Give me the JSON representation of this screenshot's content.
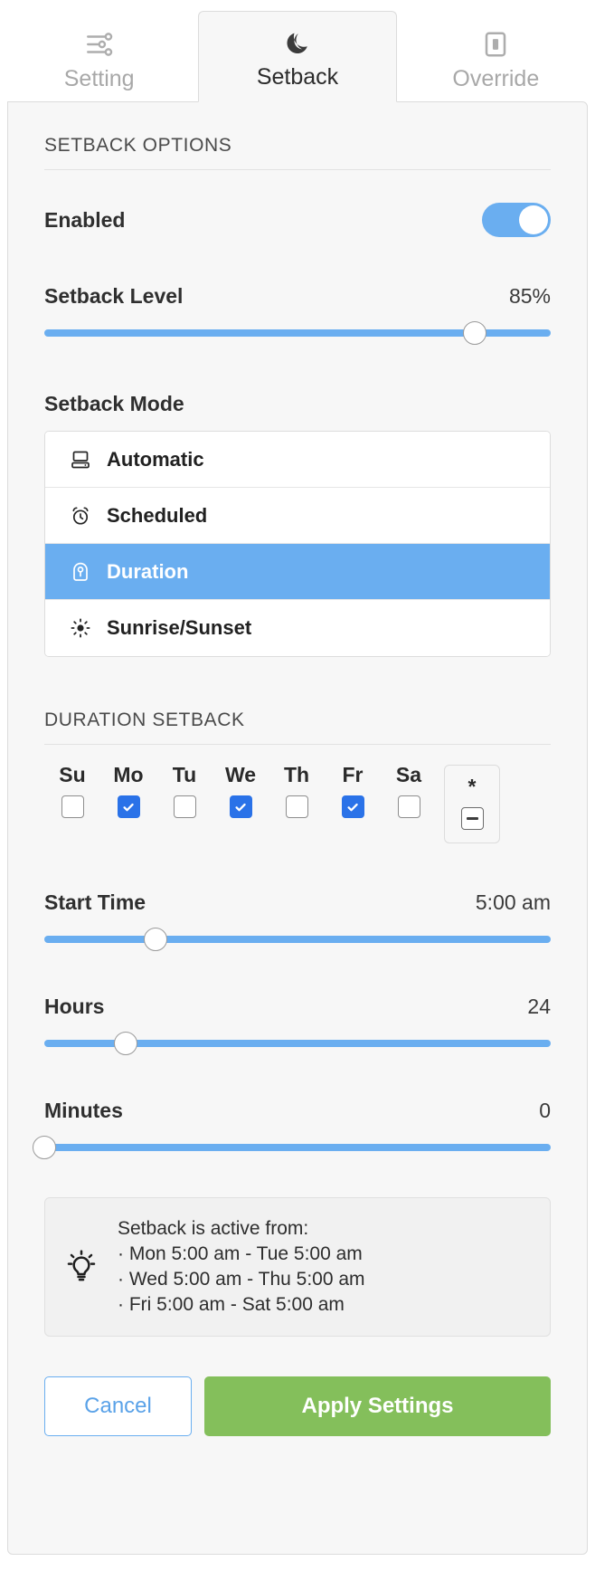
{
  "tabs": [
    {
      "label": "Setting",
      "icon": "sliders-icon",
      "active": false
    },
    {
      "label": "Setback",
      "icon": "moon-icon",
      "active": true
    },
    {
      "label": "Override",
      "icon": "switch-icon",
      "active": false
    }
  ],
  "options_section": {
    "title": "SETBACK OPTIONS",
    "enabled_label": "Enabled",
    "enabled_value": "on",
    "level_label": "Setback Level",
    "level_value": "85%",
    "level_percent": 85,
    "mode_label": "Setback Mode",
    "modes": [
      {
        "label": "Automatic",
        "icon": "computer-icon",
        "selected": false
      },
      {
        "label": "Scheduled",
        "icon": "alarm-clock-icon",
        "selected": false
      },
      {
        "label": "Duration",
        "icon": "duration-icon",
        "selected": true
      },
      {
        "label": "Sunrise/Sunset",
        "icon": "sun-icon",
        "selected": false
      }
    ]
  },
  "duration_section": {
    "title": "DURATION SETBACK",
    "days": [
      {
        "label": "Su",
        "checked": false
      },
      {
        "label": "Mo",
        "checked": true
      },
      {
        "label": "Tu",
        "checked": false
      },
      {
        "label": "We",
        "checked": true
      },
      {
        "label": "Th",
        "checked": false
      },
      {
        "label": "Fr",
        "checked": true
      },
      {
        "label": "Sa",
        "checked": false
      }
    ],
    "all_days": {
      "label": "*",
      "state": "indeterminate"
    },
    "start_time_label": "Start Time",
    "start_time_value": "5:00 am",
    "start_time_percent": 22,
    "hours_label": "Hours",
    "hours_value": "24",
    "hours_percent": 16,
    "minutes_label": "Minutes",
    "minutes_value": "0",
    "minutes_percent": 0
  },
  "info": {
    "icon": "lightbulb-icon",
    "heading": "Setback is active from:",
    "lines": [
      "· Mon 5:00 am - Tue 5:00 am",
      "· Wed 5:00 am - Thu 5:00 am",
      "· Fri 5:00 am - Sat 5:00 am"
    ]
  },
  "footer": {
    "cancel_label": "Cancel",
    "apply_label": "Apply Settings"
  },
  "colors": {
    "accent_blue": "#6aaef0",
    "checkbox_blue": "#2a72e8",
    "apply_green": "#84bf5b",
    "panel_bg": "#f7f7f7"
  }
}
